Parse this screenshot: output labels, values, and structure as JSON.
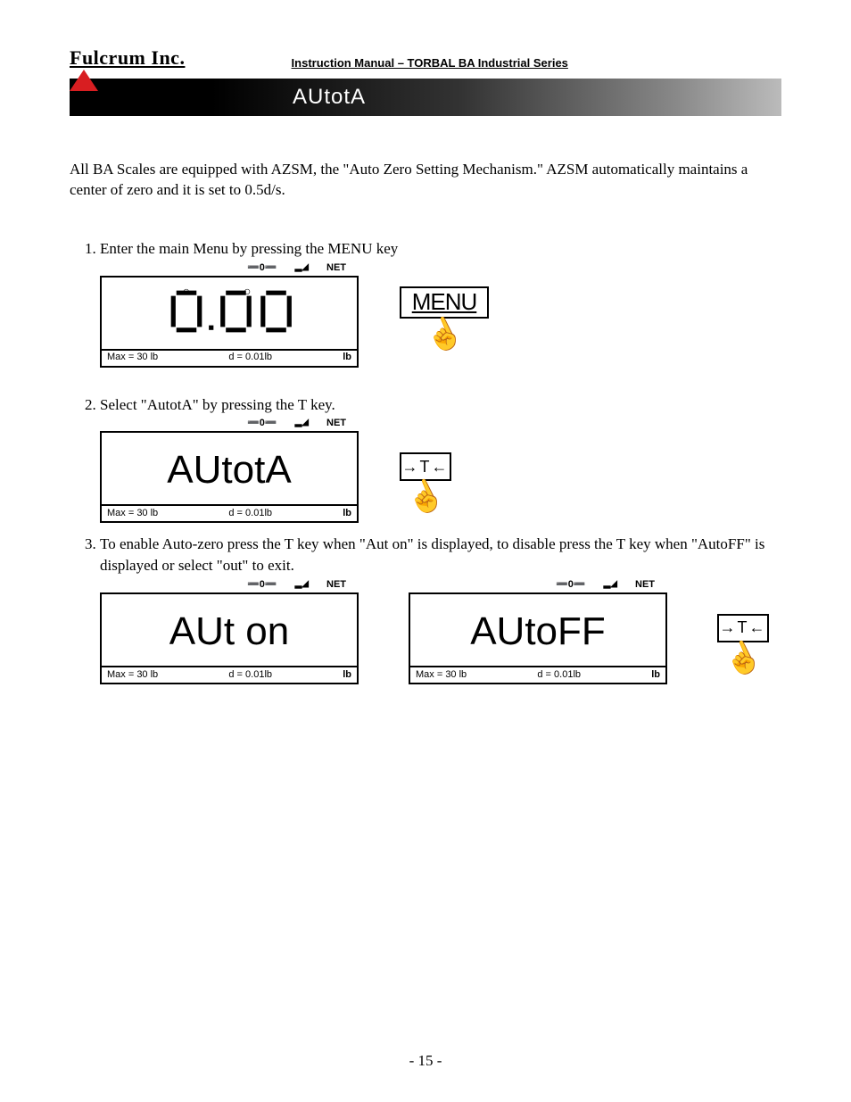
{
  "header": {
    "company": "Fulcrum Inc.",
    "manual_title": "Instruction Manual – TORBAL BA Industrial Series"
  },
  "banner": {
    "title": "AUtotA"
  },
  "intro": "All BA Scales are equipped with AZSM, the \"Auto Zero Setting Mechanism.\"  AZSM automatically maintains a center of zero and it is set to 0.5d/s.",
  "steps": [
    {
      "text": "Enter the main Menu by pressing the MENU key",
      "button_label": "MENU",
      "display": {
        "icons": {
          "zero": "➖0➖",
          "stable": "▂◢",
          "net": "NET"
        },
        "dots_visible": true,
        "main": "0.00",
        "bottom": {
          "max": "Max  =  30  lb",
          "d": "d  =  0.01lb",
          "unit": "lb"
        }
      }
    },
    {
      "text": "Select \"AutotA\" by pressing the T key.",
      "button_label": "→T←",
      "display": {
        "icons": {
          "zero": "➖0➖",
          "stable": "▂◢",
          "net": "NET"
        },
        "dots_visible": false,
        "main": "AUtotA",
        "bottom": {
          "max": "Max  =  30  lb",
          "d": "d  =  0.01lb",
          "unit": "lb"
        }
      }
    },
    {
      "text": "To enable Auto-zero press the T key when \"Aut on\" is displayed, to disable press the T key when \"AutoFF\" is displayed or select \"out\" to exit.",
      "button_label": "→T←",
      "display_a": {
        "icons": {
          "zero": "➖0➖",
          "stable": "▂◢",
          "net": "NET"
        },
        "main": "AUt on",
        "bottom": {
          "max": "Max  =  30  lb",
          "d": "d  =  0.01lb",
          "unit": "lb"
        }
      },
      "display_b": {
        "icons": {
          "zero": "➖0➖",
          "stable": "▂◢",
          "net": "NET"
        },
        "main": "AUtoFF",
        "bottom": {
          "max": "Max  =  30  lb",
          "d": "d  =  0.01lb",
          "unit": "lb"
        }
      }
    }
  ],
  "page_number": "- 15 -"
}
